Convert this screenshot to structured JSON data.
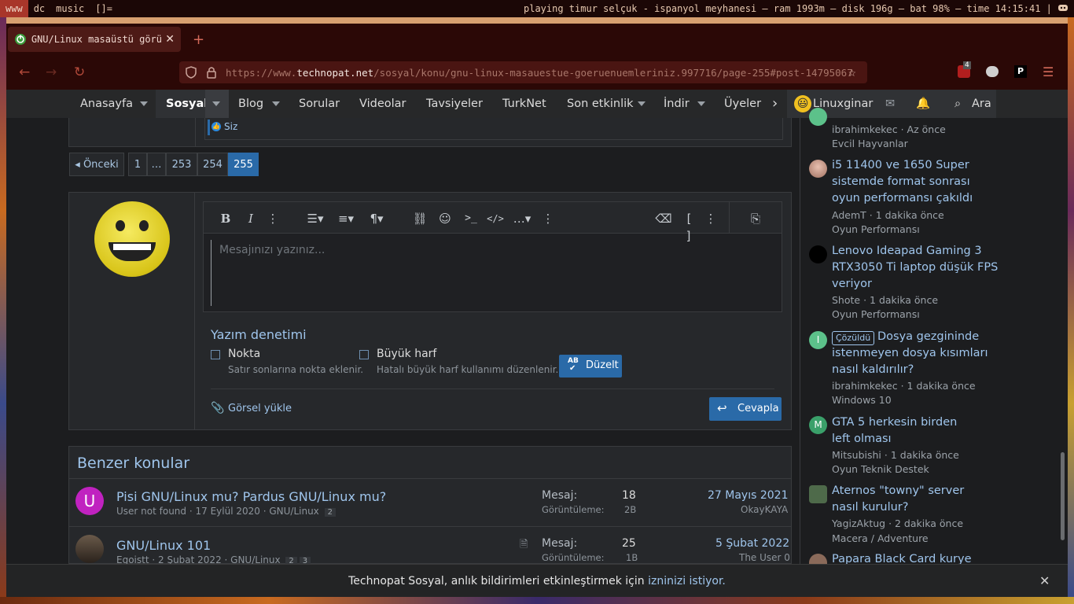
{
  "wm": {
    "workspaces": [
      "www",
      "dc",
      "music",
      "[]="
    ],
    "status": "playing timur selçuk - ispanyol meyhanesi — ram 1993m — disk 196g — bat 98% — time 14:15:41 |"
  },
  "browser": {
    "tab_title": "GNU/Linux masaüstü görünümleriniz",
    "url_prefix": "https://www.",
    "url_host": "technopat.net",
    "url_path": "/sosyal/konu/gnu-linux-masauestue-goeruenuemleriniz.997716/page-255#post-14795067",
    "ublock_count": "4",
    "ext_p": "P"
  },
  "nav": {
    "items": [
      "Anasayfa",
      "Sosyal",
      "Blog",
      "Sorular",
      "Videolar",
      "Tavsiyeler",
      "TurkNet",
      "Son etkinlik",
      "İndir",
      "Üyeler"
    ],
    "user": "Linuxginar",
    "search": "Ara"
  },
  "post": {
    "reaction_user": "Siz"
  },
  "pagination": {
    "prev": "Önceki",
    "pages": [
      "1",
      "…",
      "253",
      "254",
      "255"
    ]
  },
  "editor": {
    "placeholder": "Mesajınızı yazınız...",
    "spell_title": "Yazım denetimi",
    "opt1_label": "Nokta",
    "opt1_desc": "Satır sonlarına nokta eklenir.",
    "opt2_label": "Büyük harf",
    "opt2_desc": "Hatalı büyük harf kullanımı düzenlenir.",
    "fix_icon_text": "AB",
    "fix_label": "Düzelt",
    "upload_label": "Görsel yükle",
    "reply_label": "Cevapla"
  },
  "similar": {
    "title": "Benzer konular",
    "threads": [
      {
        "avatar_letter": "U",
        "title": "Pisi GNU/Linux mu? Pardus GNU/Linux mu?",
        "author": "User not found",
        "date": "17 Eylül 2020",
        "forum": "GNU/Linux",
        "pages": [
          "2"
        ],
        "msg_label": "Mesaj:",
        "msg": "18",
        "view_label": "Görüntüleme:",
        "views": "2B",
        "last_date": "27 Mayıs 2021",
        "last_user": "OkayKAYA"
      },
      {
        "avatar_letter": "",
        "title": "GNU/Linux 101",
        "author": "Egoistt",
        "date": "2 Şubat 2022",
        "forum": "GNU/Linux",
        "pages": [
          "2",
          "3"
        ],
        "msg_label": "Mesaj:",
        "msg": "25",
        "view_label": "Görüntüleme:",
        "views": "1B",
        "last_date": "5 Şubat 2022",
        "last_user": "The User 0"
      }
    ]
  },
  "sidebar": {
    "items": [
      {
        "title": "",
        "meta": "ibrahimkekec · Az önce",
        "forum": "Evcil Hayvanlar",
        "avatar_color": "#5cc18a",
        "avatar_letter": ""
      },
      {
        "title": "i5 11400 ve 1650 Super sistemde format sonrası oyun performansı çakıldı",
        "meta": "AdemT · 1 dakika önce",
        "forum": "Oyun Performansı",
        "avatar_color": "#c99a86",
        "avatar_letter": ""
      },
      {
        "title": "Lenovo Ideapad Gaming 3 RTX3050 Ti laptop düşük FPS veriyor",
        "meta": "Shote · 1 dakika önce",
        "forum": "Oyun Performansı",
        "avatar_color": "#000000",
        "avatar_letter": ""
      },
      {
        "badge": "Çözüldü",
        "title": "Dosya gezgininde istenmeyen dosya kısımları nasıl kaldırılır?",
        "meta": "ibrahimkekec · 1 dakika önce",
        "forum": "Windows 10",
        "avatar_color": "#5cc18a",
        "avatar_letter": "I"
      },
      {
        "title": "GTA 5 herkesin birden left olması",
        "meta": "Mitsubishi · 1 dakika önce",
        "forum": "Oyun Teknik Destek",
        "avatar_color": "#3aa06a",
        "avatar_letter": "M"
      },
      {
        "title": "Aternos \"towny\" server nasıl kurulur?",
        "meta": "YagizAktug · 2 dakika önce",
        "forum": "Macera / Adventure",
        "avatar_color": "#4e6a4a",
        "avatar_letter": ""
      },
      {
        "title": "Papara Black Card kurye",
        "meta": "",
        "forum": "",
        "avatar_color": "#8a6a5a",
        "avatar_letter": ""
      }
    ]
  },
  "notice": {
    "text": "Technopat Sosyal, anlık bildirimleri etkinleştirmek için ",
    "link": "izninizi istiyor."
  },
  "colors": {
    "accent": "#2a6aa8",
    "link": "#9fc5ec",
    "page_bg": "#1c1d1f",
    "chrome": "#2b0806"
  }
}
